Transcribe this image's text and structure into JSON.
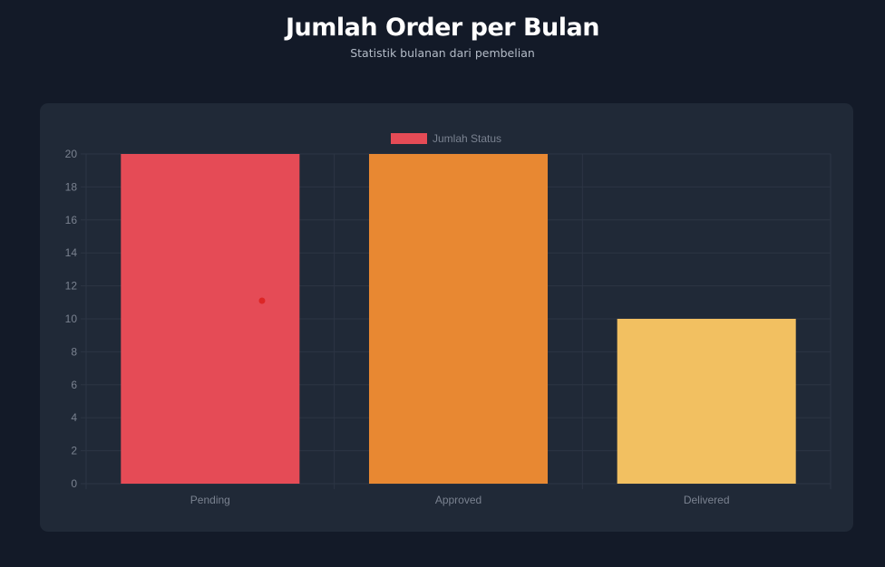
{
  "page": {
    "title": "Jumlah Order per Bulan",
    "subtitle": "Statistik bulanan dari pembelian"
  },
  "colors": {
    "background": "#131a28",
    "card": "#202937",
    "grid": "#2c3544",
    "text": "#7a8290",
    "marker": "#dc2626"
  },
  "chart_data": {
    "type": "bar",
    "title": "",
    "xlabel": "",
    "ylabel": "",
    "categories": [
      "Pending",
      "Approved",
      "Delivered"
    ],
    "series": [
      {
        "name": "Jumlah Status",
        "values": [
          20,
          20,
          10
        ],
        "colors": [
          "#e54b56",
          "#e88832",
          "#f2c061"
        ]
      }
    ],
    "ylim": [
      0,
      20
    ],
    "yticks": [
      0,
      2,
      4,
      6,
      8,
      10,
      12,
      14,
      16,
      18,
      20
    ],
    "grid": true,
    "legend_position": "top-center",
    "marker_point": {
      "category": "Pending",
      "y": 11.1
    }
  }
}
